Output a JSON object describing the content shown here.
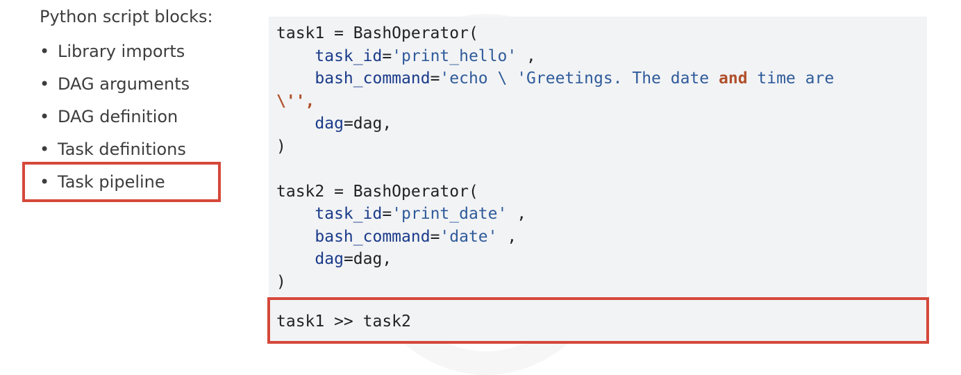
{
  "sidebar": {
    "heading": "Python script blocks:",
    "bullet": "•",
    "items": [
      {
        "label": "Library imports"
      },
      {
        "label": "DAG arguments"
      },
      {
        "label": "DAG definition"
      },
      {
        "label": "Task definitions"
      },
      {
        "label": "Task pipeline"
      }
    ],
    "highlighted_item": "Task pipeline"
  },
  "code": {
    "task1": {
      "assign": "task1 = BashOperator(",
      "task_id_key": "task_id",
      "task_id_value": "'print_hello'",
      "bash_command_key": "bash_command",
      "bash_command_value_part1": "'echo \\ 'Greetings. The date ",
      "bash_command_keyword": "and",
      "bash_command_value_part2": " time are",
      "bash_command_continuation": "\\'',",
      "dag_key": "dag",
      "dag_value": "dag,",
      "close": ")"
    },
    "task2": {
      "assign": "task2 = BashOperator(",
      "task_id_key": "task_id",
      "task_id_value": "'print_date'",
      "bash_command_key": "bash_command",
      "bash_command_value": "'date'",
      "dag_key": "dag",
      "dag_value": "dag,",
      "close": ")"
    },
    "pipeline": "task1 >> task2"
  },
  "colors": {
    "highlight_border": "#d5483a",
    "code_background": "#f2f3f5",
    "keyword_arg": "#1a3b8a",
    "string": "#2f5b9a",
    "keyword": "#b0502c"
  }
}
